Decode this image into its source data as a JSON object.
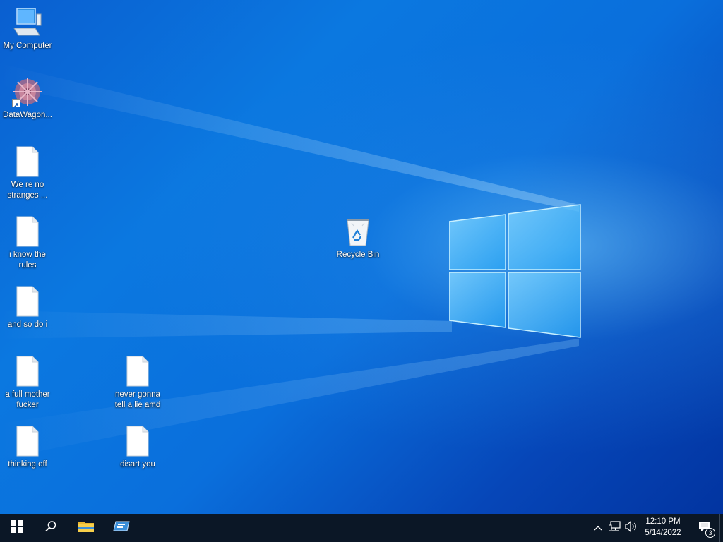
{
  "desktop": {
    "icons": [
      {
        "label": "My Computer",
        "type": "computer"
      },
      {
        "label": "DataWagon...",
        "type": "shortcut"
      },
      {
        "label": "We re no stranges ...",
        "type": "text-file"
      },
      {
        "label": "i know the rules",
        "type": "text-file"
      },
      {
        "label": "and so do i",
        "type": "text-file"
      },
      {
        "label": "a full mother fucker",
        "type": "text-file"
      },
      {
        "label": "thinking off",
        "type": "text-file"
      },
      {
        "label": "never gonna tell a lie amd",
        "type": "text-file"
      },
      {
        "label": "disart you",
        "type": "text-file"
      },
      {
        "label": "Recycle Bin",
        "type": "recycle-bin"
      }
    ]
  },
  "taskbar": {
    "start_icon": "windows-start-icon",
    "search_icon": "search-icon",
    "pinned": [
      "file-explorer-icon",
      "server-manager-icon"
    ],
    "tray_icons": [
      "chevron-up-icon",
      "network-icon",
      "volume-icon"
    ],
    "clock": {
      "time": "12:10 PM",
      "date": "5/14/2022"
    },
    "notifications": {
      "count": "3"
    }
  },
  "colors": {
    "taskbar_bg": "#0b1726",
    "desktop_accent": "#0a78e0"
  }
}
